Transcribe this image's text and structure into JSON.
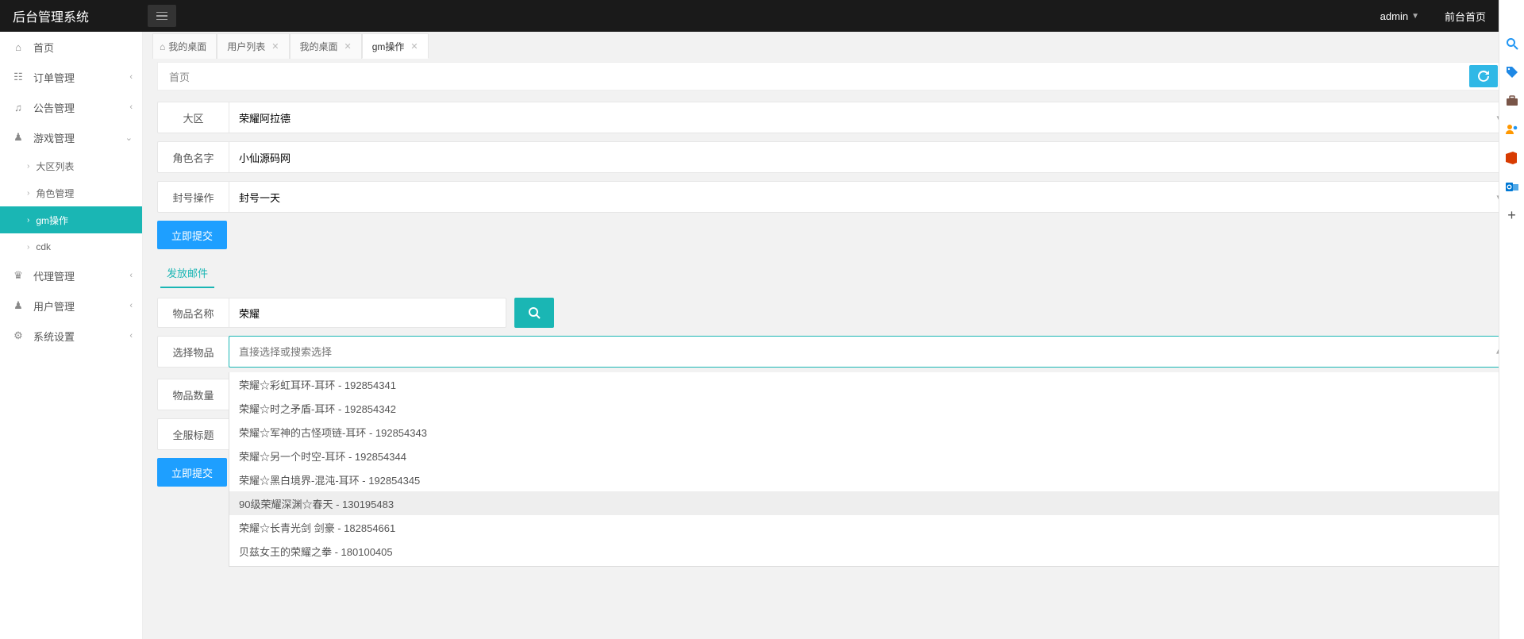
{
  "topbar": {
    "brand": "后台管理系统",
    "user": "admin",
    "front_link": "前台首页"
  },
  "sidebar": {
    "items": [
      {
        "icon": "home",
        "label": "首页",
        "has_sub": false
      },
      {
        "icon": "doc",
        "label": "订单管理",
        "has_sub": true
      },
      {
        "icon": "speaker",
        "label": "公告管理",
        "has_sub": true
      },
      {
        "icon": "game",
        "label": "游戏管理",
        "has_sub": true,
        "expanded": true,
        "subs": [
          {
            "label": "大区列表"
          },
          {
            "label": "角色管理"
          },
          {
            "label": "gm操作",
            "active": true
          },
          {
            "label": "cdk"
          }
        ]
      },
      {
        "icon": "agent",
        "label": "代理管理",
        "has_sub": true
      },
      {
        "icon": "users",
        "label": "用户管理",
        "has_sub": true
      },
      {
        "icon": "gear",
        "label": "系统设置",
        "has_sub": true
      }
    ]
  },
  "tabs": [
    {
      "label": "我的桌面",
      "home": true
    },
    {
      "label": "用户列表"
    },
    {
      "label": "我的桌面"
    },
    {
      "label": "gm操作",
      "active": true
    }
  ],
  "breadcrumb": {
    "text": "首页"
  },
  "form": {
    "region_label": "大区",
    "region_value": "荣耀阿拉德",
    "role_label": "角色名字",
    "role_value": "小仙源码网",
    "ban_label": "封号操作",
    "ban_value": "封号一天",
    "submit1": "立即提交",
    "section_mail": "发放邮件",
    "item_name_label": "物品名称",
    "item_name_value": "荣耀",
    "select_item_label": "选择物品",
    "select_item_placeholder": "直接选择或搜索选择",
    "item_qty_label": "物品数量",
    "title_label": "全服标题",
    "submit2": "立即提交"
  },
  "dropdown_items": [
    {
      "label": "荣耀☆彩虹耳环-耳环 - 192854341"
    },
    {
      "label": "荣耀☆时之矛盾-耳环 - 192854342"
    },
    {
      "label": "荣耀☆军神的古怪项链-耳环 - 192854343"
    },
    {
      "label": "荣耀☆另一个时空-耳环 - 192854344"
    },
    {
      "label": "荣耀☆黑白境界-混沌-耳环 - 192854345"
    },
    {
      "label": "90级荣耀深渊☆春天 - 130195483",
      "hl": true
    },
    {
      "label": "荣耀☆长青光剑 剑豪 - 182854661"
    },
    {
      "label": "贝兹女王的荣耀之拳 - 180100405"
    }
  ],
  "rightbar_colors": {
    "search": "#2196F3",
    "tag": "#1E88E5",
    "brief": "#795548",
    "people": "#FF9800",
    "office": "#D83B01",
    "outlook": "#0078D4",
    "plus": "#555"
  }
}
